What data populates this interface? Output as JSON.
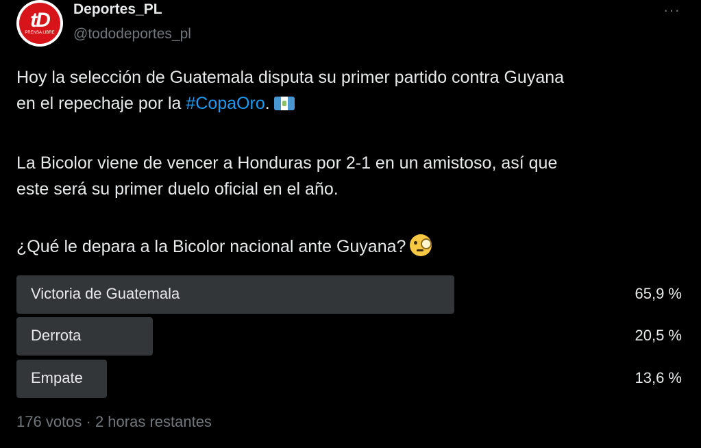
{
  "tweet": {
    "display_name": "Deportes_PL",
    "handle": "@tododeportes_pl",
    "more_icon": "···",
    "avatar_logo": "tD",
    "avatar_sub": "PRENSA LIBRE",
    "line1": "Hoy la selección de Guatemala disputa su primer partido contra Guyana",
    "line2_prefix": "en el repechaje por la ",
    "hashtag": "#CopaOro",
    "line2_suffix": ".",
    "flag_icon": "guatemala-flag",
    "line3": "La Bicolor viene de vencer a Honduras por 2-1 en un amistoso, así que",
    "line4": "este será su primer duelo oficial en el año.",
    "line5": "¿Qué le depara a la Bicolor nacional ante Guyana?",
    "emoji_icon": "face-with-monocle"
  },
  "poll": {
    "options": [
      {
        "label": "Victoria de Guatemala",
        "percent_text": "65,9 %",
        "percent": 65.9
      },
      {
        "label": "Derrota",
        "percent_text": "20,5 %",
        "percent": 20.5
      },
      {
        "label": "Empate",
        "percent_text": "13,6 %",
        "percent": 13.6
      }
    ],
    "footer": "176 votos · 2 horas restantes"
  }
}
